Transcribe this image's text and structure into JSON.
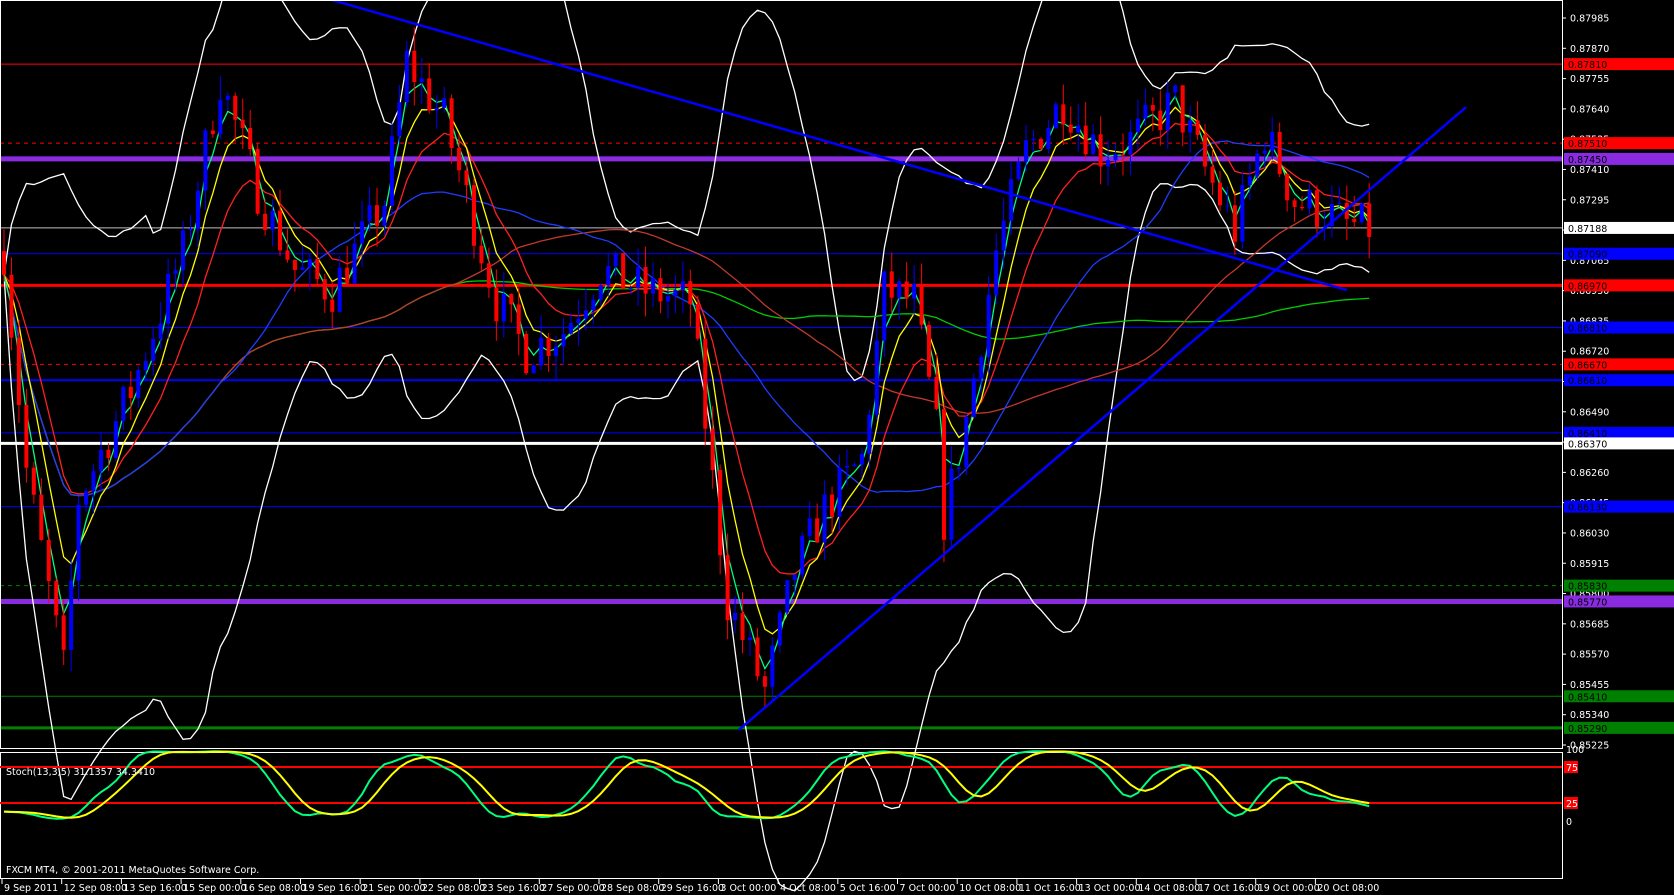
{
  "chart_data": {
    "type": "candlestick",
    "symbol_note": "FXCM MT4, © 2001-2011 MetaQuotes Software Corp.",
    "stoch_label": "Stoch(13,3,5) 31.1357 34.3410",
    "ylim": [
      0.85225,
      0.87985
    ],
    "price_ticks": [
      "0.87985",
      "0.87870",
      "0.87755",
      "0.87640",
      "0.87525",
      "0.87410",
      "0.87295",
      "0.87180",
      "0.87065",
      "0.86950",
      "0.86835",
      "0.86720",
      "0.86605",
      "0.86490",
      "0.86375",
      "0.86260",
      "0.86145",
      "0.86030",
      "0.85915",
      "0.85800",
      "0.85685",
      "0.85570",
      "0.85455",
      "0.85340",
      "0.85225"
    ],
    "time_labels": [
      "9 Sep 2011",
      "12 Sep 08:00",
      "13 Sep 16:00",
      "15 Sep 00:00",
      "16 Sep 08:00",
      "19 Sep 16:00",
      "21 Sep 00:00",
      "22 Sep 08:00",
      "23 Sep 16:00",
      "27 Sep 00:00",
      "28 Sep 08:00",
      "29 Sep 16:00",
      "3 Oct 00:00",
      "4 Oct 08:00",
      "5 Oct 16:00",
      "7 Oct 00:00",
      "10 Oct 08:00",
      "11 Oct 16:00",
      "13 Oct 00:00",
      "14 Oct 08:00",
      "17 Oct 16:00",
      "19 Oct 00:00",
      "20 Oct 08:00"
    ],
    "price_path": [
      [
        0,
        0.871
      ],
      [
        3,
        0.8627
      ],
      [
        8,
        0.8551
      ],
      [
        10,
        0.8616
      ],
      [
        17,
        0.8657
      ],
      [
        24,
        0.871
      ],
      [
        29,
        0.8775
      ],
      [
        34,
        0.8733
      ],
      [
        39,
        0.8703
      ],
      [
        44,
        0.8695
      ],
      [
        51,
        0.8729
      ],
      [
        54,
        0.8782
      ],
      [
        59,
        0.876
      ],
      [
        66,
        0.8691
      ],
      [
        70,
        0.8672
      ],
      [
        75,
        0.868
      ],
      [
        80,
        0.8703
      ],
      [
        86,
        0.8695
      ],
      [
        92,
        0.8691
      ],
      [
        97,
        0.8577
      ],
      [
        102,
        0.8543
      ],
      [
        106,
        0.8589
      ],
      [
        110,
        0.8612
      ],
      [
        115,
        0.8631
      ],
      [
        118,
        0.8695
      ],
      [
        122,
        0.8691
      ],
      [
        125,
        0.8642
      ],
      [
        126,
        0.8608
      ],
      [
        129,
        0.8646
      ],
      [
        133,
        0.871
      ],
      [
        137,
        0.8748
      ],
      [
        142,
        0.8767
      ],
      [
        147,
        0.8748
      ],
      [
        151,
        0.8752
      ],
      [
        157,
        0.8767
      ],
      [
        161,
        0.8741
      ],
      [
        165,
        0.8718
      ],
      [
        169,
        0.8755
      ],
      [
        173,
        0.8729
      ],
      [
        177,
        0.8725
      ],
      [
        180,
        0.872
      ],
      [
        183,
        0.87188
      ]
    ],
    "levels": [
      {
        "price": "0.87810",
        "color": "#ff0000",
        "style": "solid",
        "weight": 1
      },
      {
        "price": "0.87510",
        "color": "#ff0000",
        "style": "dash",
        "weight": 1
      },
      {
        "price": "0.87450",
        "color": "#8a2be2",
        "style": "solid",
        "weight": 5
      },
      {
        "price": "0.87188",
        "color": "#c0c0c0",
        "style": "solid",
        "weight": 1
      },
      {
        "price": "0.87090",
        "color": "#0000ff",
        "style": "solid",
        "weight": 1
      },
      {
        "price": "0.86970",
        "color": "#ff0000",
        "style": "solid",
        "weight": 3
      },
      {
        "price": "0.86810",
        "color": "#0000ff",
        "style": "solid",
        "weight": 1
      },
      {
        "price": "0.86670",
        "color": "#ff0000",
        "style": "dash",
        "weight": 1
      },
      {
        "price": "0.86610",
        "color": "#0000ff",
        "style": "solid",
        "weight": 2
      },
      {
        "price": "0.86410",
        "color": "#0000ff",
        "style": "solid",
        "weight": 1
      },
      {
        "price": "0.86370",
        "color": "#ffffff",
        "style": "solid",
        "weight": 3
      },
      {
        "price": "0.86130",
        "color": "#0000ff",
        "style": "solid",
        "weight": 1
      },
      {
        "price": "0.85830",
        "color": "#008000",
        "style": "dash",
        "weight": 1
      },
      {
        "price": "0.85770",
        "color": "#8a2be2",
        "style": "solid",
        "weight": 5
      },
      {
        "price": "0.85410",
        "color": "#008000",
        "style": "solid",
        "weight": 1
      },
      {
        "price": "0.85290",
        "color": "#008000",
        "style": "solid",
        "weight": 3
      }
    ],
    "trendlines": [
      {
        "from": [
          44,
          0.88053
        ],
        "to": [
          180,
          0.86952
        ],
        "color": "#0000ff"
      },
      {
        "from": [
          98.5,
          0.85282
        ],
        "to": [
          196,
          0.87647
        ],
        "color": "#0000ff"
      }
    ],
    "stoch_levels": [
      "100",
      "75",
      "25",
      "0"
    ],
    "colors": {
      "bull": "#0000ff",
      "bear": "#ff0000",
      "bands": "#ffffff",
      "ema_fast": "#00ff7f",
      "ema_mid": "#ffff00",
      "ema_slow": "#ff2020",
      "sma_blue": "#1e3cff",
      "sma_green": "#00cc00",
      "sma_red2": "#c0392b"
    }
  }
}
